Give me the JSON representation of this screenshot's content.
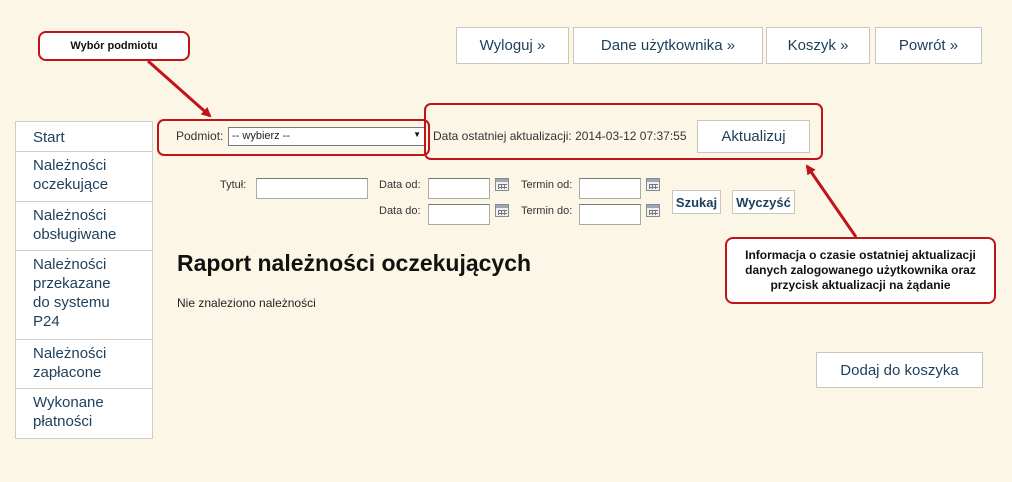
{
  "header": {
    "buttons": [
      "Wyloguj »",
      "Dane użytkownika »",
      "Koszyk »",
      "Powrót »"
    ]
  },
  "sidebar": {
    "items": [
      "Start",
      "Należności\noczekujące",
      "Należności\nobsługiwane",
      "Należności\nprzekazane\ndo systemu\nP24",
      "Należności\nzapłacone",
      "Wykonane\npłatności"
    ]
  },
  "entity": {
    "label": "Podmiot:",
    "selected": "-- wybierz --",
    "update_text": "Data ostatniej aktualizacji: 2014-03-12 07:37:55",
    "update_button": "Aktualizuj"
  },
  "filters": {
    "title_label": "Tytuł:",
    "date_from_label": "Data od:",
    "date_to_label": "Data do:",
    "due_from_label": "Termin od:",
    "due_to_label": "Termin do:",
    "search_button": "Szukaj",
    "clear_button": "Wyczyść"
  },
  "main": {
    "heading": "Raport należności oczekujących",
    "empty_message": "Nie znaleziono należności",
    "add_to_cart_button": "Dodaj do koszyka"
  },
  "annotations": {
    "entity_callout": "Wybór podmiotu",
    "update_callout": "Informacja o czasie ostatniej aktualizacji danych zalogowanego użytkownika oraz przycisk aktualizacji na żądanie"
  },
  "colors": {
    "background": "#fcf6e6",
    "link_text": "#1c3f5c",
    "annotation_red": "#c0141b"
  }
}
